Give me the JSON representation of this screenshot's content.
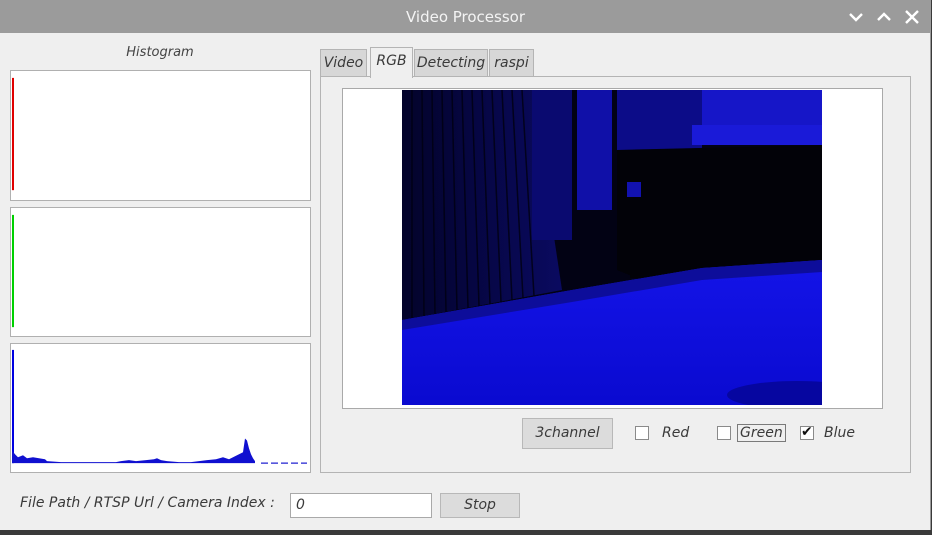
{
  "window": {
    "title": "Video Processor",
    "controls": [
      "minimize-icon",
      "maximize-icon",
      "close-icon"
    ]
  },
  "histogram": {
    "label": "Histogram",
    "channels": [
      {
        "name": "red",
        "color": "#e00000"
      },
      {
        "name": "green",
        "color": "#00d000"
      },
      {
        "name": "blue",
        "color": "#0000e0"
      }
    ]
  },
  "tabs": [
    {
      "label": "Video",
      "active": false
    },
    {
      "label": "RGB",
      "active": true
    },
    {
      "label": "Detecting",
      "active": false
    },
    {
      "label": "raspi",
      "active": false
    }
  ],
  "rgb": {
    "button_label": "3channel",
    "checks": [
      {
        "label": "Red",
        "checked": false
      },
      {
        "label": "Green",
        "checked": false
      },
      {
        "label": "Blue",
        "checked": true
      }
    ]
  },
  "source": {
    "label": "File Path / RTSP Url / Camera Index :",
    "value": "0",
    "stop_label": "Stop"
  }
}
